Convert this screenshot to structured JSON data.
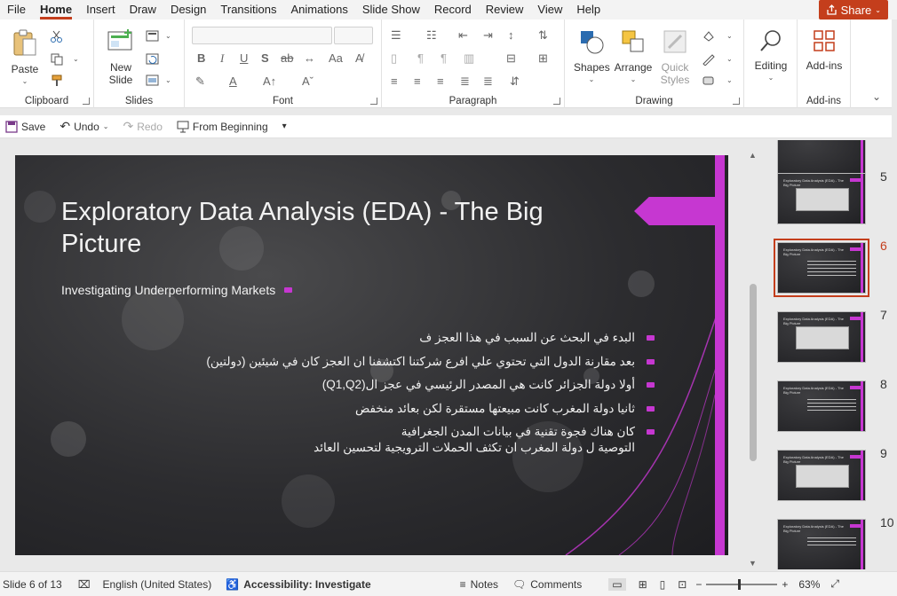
{
  "menu": {
    "tabs": [
      "File",
      "Home",
      "Insert",
      "Draw",
      "Design",
      "Transitions",
      "Animations",
      "Slide Show",
      "Record",
      "Review",
      "View",
      "Help"
    ],
    "active": "Home",
    "share_label": "Share"
  },
  "ribbon": {
    "clipboard": {
      "label": "Clipboard",
      "paste": "Paste"
    },
    "slides": {
      "label": "Slides",
      "new_slide": "New\nSlide"
    },
    "font": {
      "label": "Font"
    },
    "paragraph": {
      "label": "Paragraph"
    },
    "drawing": {
      "label": "Drawing",
      "shapes": "Shapes",
      "arrange": "Arrange",
      "quick_styles": "Quick\nStyles"
    },
    "editing": {
      "label": "Editing"
    },
    "addins": {
      "label": "Add-ins",
      "addins_btn": "Add-ins"
    }
  },
  "qat": {
    "save": "Save",
    "undo": "Undo",
    "redo": "Redo",
    "from_beginning": "From Beginning"
  },
  "slide": {
    "title": "Exploratory Data Analysis (EDA) - The Big Picture",
    "subtitle": "Investigating Underperforming Markets",
    "lines": [
      "البدء في البحث عن السبب في هذا العجز ف",
      "بعد مقارنة الدول التي تحتوي علي افرع شركتنا اكتشفنا ان العجز كان في شيئين (دولتين)",
      "أولا دولة الجزائر كانت هي المصدر الرئيسي في عجز ال(Q1,Q2)",
      "ثانيا دولة المغرب كانت مبيعتها مستقرة لكن بعائد منخفض",
      "كان هناك فجوة تقنية في بيانات المدن الجغرافية",
      "التوصية ل دولة المغرب ان تكثف الحملات الترويجية لتحسين العائد"
    ],
    "accent_color": "#c637d1"
  },
  "thumbnails": {
    "numbers": [
      "5",
      "6",
      "7",
      "8",
      "9",
      "10"
    ],
    "selected": "6",
    "mini_title": "Exploratory Data Analysis (EDA) - The Big Picture"
  },
  "status": {
    "slide_counter": "Slide 6 of 13",
    "language": "English (United States)",
    "accessibility": "Accessibility: Investigate",
    "notes": "Notes",
    "comments": "Comments",
    "zoom": "63%"
  },
  "colors": {
    "accent": "#c43e1c",
    "slide_accent": "#c637d1"
  }
}
